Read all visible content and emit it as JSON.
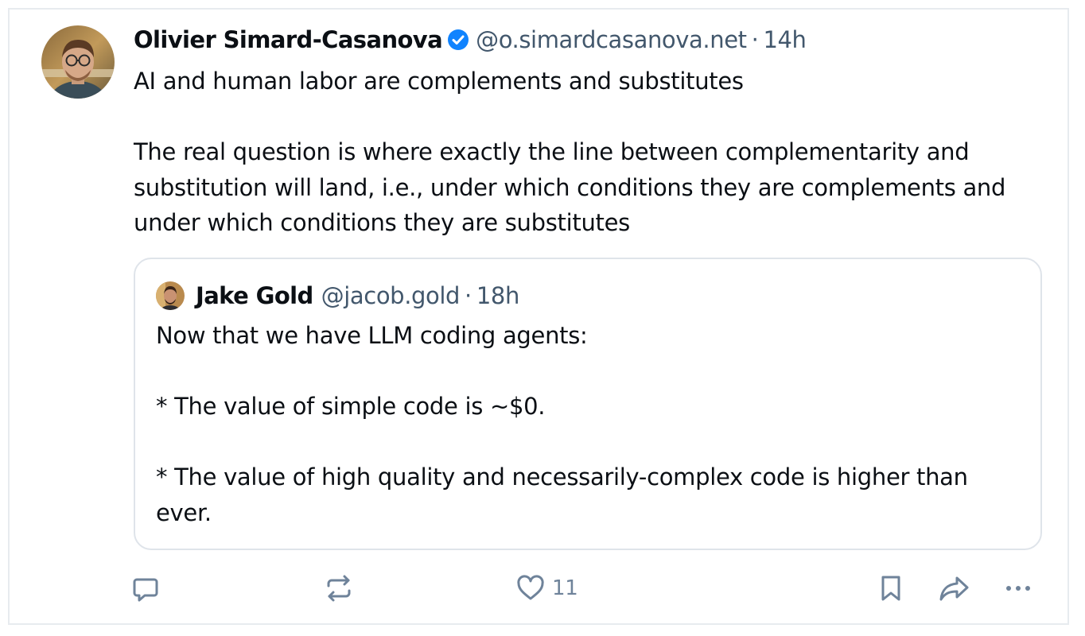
{
  "post": {
    "author": {
      "name": "Olivier Simard-Casanova",
      "handle": "@o.simardcasanova.net",
      "verified": true
    },
    "separator": "·",
    "time": "14h",
    "paragraphs": [
      "AI and human labor are complements and substitutes",
      "The real question is where exactly the line between complementarity and substitution will land, i.e., under which conditions they are complements and under which conditions they are substitutes"
    ]
  },
  "quote": {
    "author": {
      "name": "Jake Gold",
      "handle": "@jacob.gold"
    },
    "separator": "·",
    "time": "18h",
    "paragraphs": [
      "Now that we have LLM coding agents:",
      "* The value of simple code is ~$0.",
      "* The value of high quality and necessarily-complex code is higher than ever."
    ]
  },
  "actions": {
    "reply": {
      "icon": "reply-icon"
    },
    "repost": {
      "icon": "repost-icon"
    },
    "like": {
      "icon": "heart-icon",
      "count": "11"
    },
    "bookmark": {
      "icon": "bookmark-icon"
    },
    "share": {
      "icon": "share-icon"
    },
    "more": {
      "icon": "more-icon"
    }
  },
  "colors": {
    "text": "#0b0f14",
    "muted": "#42576c",
    "icon": "#6f839a",
    "verified": "#1083fe",
    "border": "#dfe4ea"
  }
}
